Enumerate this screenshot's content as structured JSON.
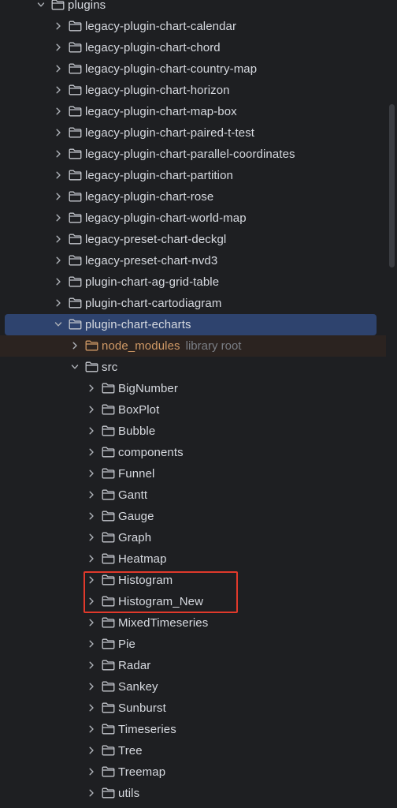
{
  "colors": {
    "background": "#1e1f22",
    "selected_row": "#2e436e",
    "excluded_row": "#2b2320",
    "text": "#d7dae0",
    "excluded_text": "#d19a66",
    "hint_text": "#7a7e85",
    "annotation_box": "#e0392b"
  },
  "tree": {
    "items": [
      {
        "label": "plugins",
        "depth": 0,
        "expanded": true,
        "icon": "folder-icon"
      },
      {
        "label": "legacy-plugin-chart-calendar",
        "depth": 1,
        "expanded": false,
        "icon": "folder-icon"
      },
      {
        "label": "legacy-plugin-chart-chord",
        "depth": 1,
        "expanded": false,
        "icon": "folder-icon"
      },
      {
        "label": "legacy-plugin-chart-country-map",
        "depth": 1,
        "expanded": false,
        "icon": "folder-icon"
      },
      {
        "label": "legacy-plugin-chart-horizon",
        "depth": 1,
        "expanded": false,
        "icon": "folder-icon"
      },
      {
        "label": "legacy-plugin-chart-map-box",
        "depth": 1,
        "expanded": false,
        "icon": "folder-icon"
      },
      {
        "label": "legacy-plugin-chart-paired-t-test",
        "depth": 1,
        "expanded": false,
        "icon": "folder-icon"
      },
      {
        "label": "legacy-plugin-chart-parallel-coordinates",
        "depth": 1,
        "expanded": false,
        "icon": "folder-icon"
      },
      {
        "label": "legacy-plugin-chart-partition",
        "depth": 1,
        "expanded": false,
        "icon": "folder-icon"
      },
      {
        "label": "legacy-plugin-chart-rose",
        "depth": 1,
        "expanded": false,
        "icon": "folder-icon"
      },
      {
        "label": "legacy-plugin-chart-world-map",
        "depth": 1,
        "expanded": false,
        "icon": "folder-icon"
      },
      {
        "label": "legacy-preset-chart-deckgl",
        "depth": 1,
        "expanded": false,
        "icon": "folder-icon"
      },
      {
        "label": "legacy-preset-chart-nvd3",
        "depth": 1,
        "expanded": false,
        "icon": "folder-icon"
      },
      {
        "label": "plugin-chart-ag-grid-table",
        "depth": 1,
        "expanded": false,
        "icon": "folder-icon"
      },
      {
        "label": "plugin-chart-cartodiagram",
        "depth": 1,
        "expanded": false,
        "icon": "folder-icon"
      },
      {
        "label": "plugin-chart-echarts",
        "depth": 1,
        "expanded": true,
        "icon": "folder-icon",
        "selected": true
      },
      {
        "label": "node_modules",
        "depth": 2,
        "expanded": false,
        "icon": "excluded-folder-icon",
        "hint": "library root",
        "excluded": true
      },
      {
        "label": "src",
        "depth": 2,
        "expanded": true,
        "icon": "folder-icon"
      },
      {
        "label": "BigNumber",
        "depth": 3,
        "expanded": false,
        "icon": "folder-icon"
      },
      {
        "label": "BoxPlot",
        "depth": 3,
        "expanded": false,
        "icon": "folder-icon"
      },
      {
        "label": "Bubble",
        "depth": 3,
        "expanded": false,
        "icon": "folder-icon"
      },
      {
        "label": "components",
        "depth": 3,
        "expanded": false,
        "icon": "folder-icon"
      },
      {
        "label": "Funnel",
        "depth": 3,
        "expanded": false,
        "icon": "folder-icon"
      },
      {
        "label": "Gantt",
        "depth": 3,
        "expanded": false,
        "icon": "folder-icon"
      },
      {
        "label": "Gauge",
        "depth": 3,
        "expanded": false,
        "icon": "folder-icon"
      },
      {
        "label": "Graph",
        "depth": 3,
        "expanded": false,
        "icon": "folder-icon"
      },
      {
        "label": "Heatmap",
        "depth": 3,
        "expanded": false,
        "icon": "folder-icon"
      },
      {
        "label": "Histogram",
        "depth": 3,
        "expanded": false,
        "icon": "folder-icon"
      },
      {
        "label": "Histogram_New",
        "depth": 3,
        "expanded": false,
        "icon": "folder-icon"
      },
      {
        "label": "MixedTimeseries",
        "depth": 3,
        "expanded": false,
        "icon": "folder-icon"
      },
      {
        "label": "Pie",
        "depth": 3,
        "expanded": false,
        "icon": "folder-icon"
      },
      {
        "label": "Radar",
        "depth": 3,
        "expanded": false,
        "icon": "folder-icon"
      },
      {
        "label": "Sankey",
        "depth": 3,
        "expanded": false,
        "icon": "folder-icon"
      },
      {
        "label": "Sunburst",
        "depth": 3,
        "expanded": false,
        "icon": "folder-icon"
      },
      {
        "label": "Timeseries",
        "depth": 3,
        "expanded": false,
        "icon": "folder-icon"
      },
      {
        "label": "Tree",
        "depth": 3,
        "expanded": false,
        "icon": "folder-icon"
      },
      {
        "label": "Treemap",
        "depth": 3,
        "expanded": false,
        "icon": "folder-icon"
      },
      {
        "label": "utils",
        "depth": 3,
        "expanded": false,
        "icon": "folder-icon"
      }
    ]
  },
  "annotation": {
    "highlighted_items": [
      "Histogram",
      "Histogram_New"
    ]
  }
}
